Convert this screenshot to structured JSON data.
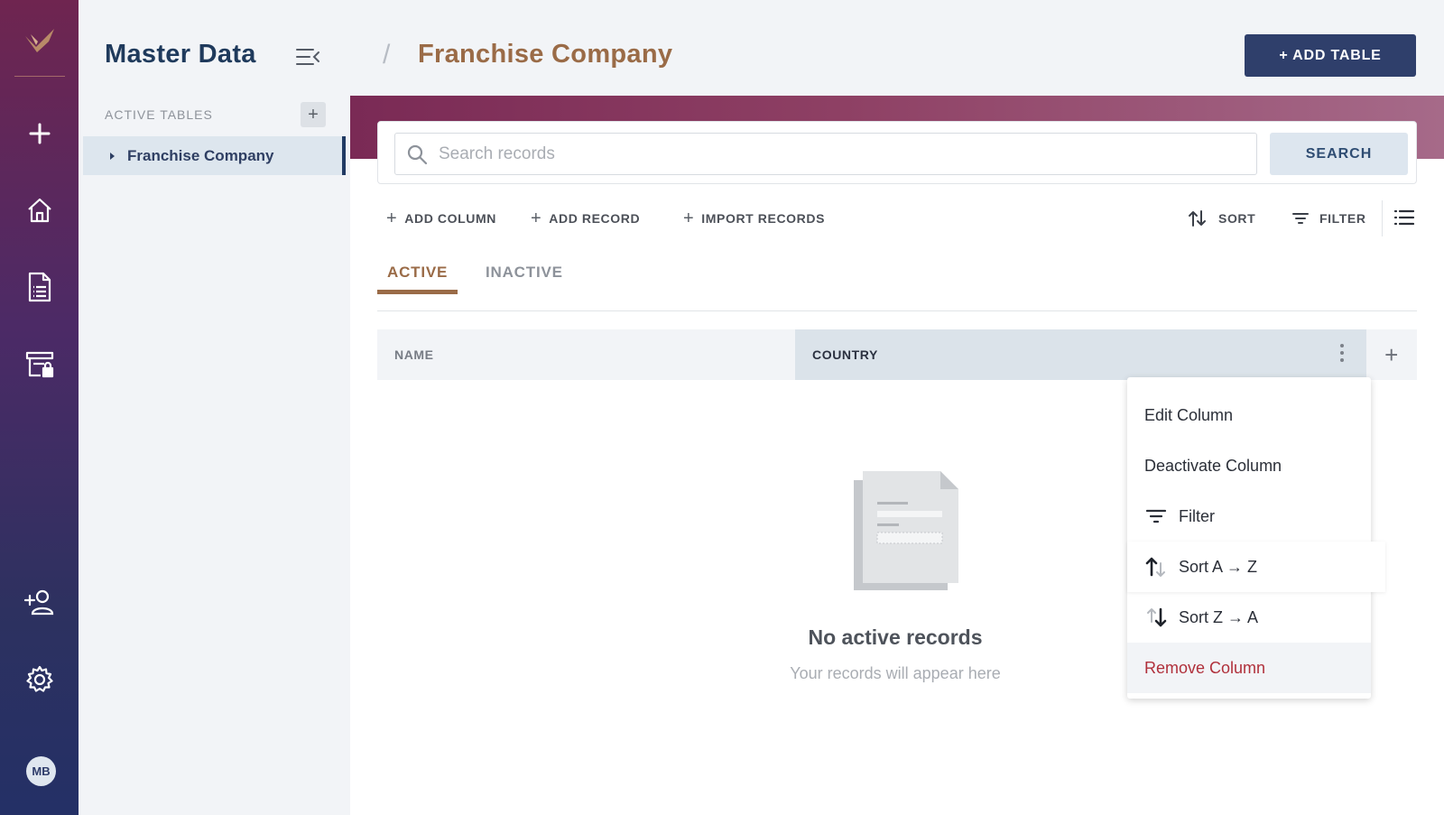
{
  "rail": {
    "icons": [
      "logo-bird-icon",
      "plus-icon",
      "home-icon",
      "document-list-icon",
      "table-lock-icon",
      "add-user-icon",
      "gear-icon"
    ],
    "avatar_initials": "MB"
  },
  "side": {
    "title": "Master Data",
    "section_label": "ACTIVE TABLES",
    "add_label": "+",
    "items": [
      {
        "label": "Franchise Company"
      }
    ]
  },
  "header": {
    "separator": "/",
    "breadcrumb": "Franchise Company",
    "add_table_label": "+ ADD TABLE"
  },
  "search": {
    "placeholder": "Search records",
    "button_label": "SEARCH"
  },
  "toolbar": {
    "add_column": "ADD COLUMN",
    "add_record": "ADD RECORD",
    "import_records": "IMPORT RECORDS",
    "sort": "SORT",
    "filter": "FILTER"
  },
  "tabs": [
    {
      "label": "ACTIVE"
    },
    {
      "label": "INACTIVE"
    }
  ],
  "table": {
    "columns": [
      "NAME",
      "COUNTRY"
    ],
    "add_column_symbol": "+"
  },
  "empty": {
    "title": "No active records",
    "subtitle": "Your records will appear here"
  },
  "column_menu": {
    "items": [
      {
        "label": "Edit Column"
      },
      {
        "label": "Deactivate Column"
      },
      {
        "label": "Filter"
      },
      {
        "label": "Sort  A → Z"
      },
      {
        "label": "Sort  Z → A"
      },
      {
        "label": "Remove Column"
      }
    ]
  },
  "colors": {
    "accent_brown": "#9a6b47",
    "navy": "#2f3f6b",
    "danger": "#b0303b"
  }
}
